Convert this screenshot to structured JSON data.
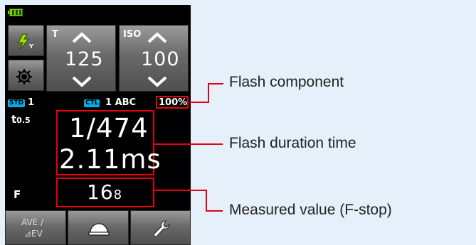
{
  "status_bar": {
    "battery_icon": "battery-full-icon"
  },
  "left_buttons": {
    "flash_mode_icon": "flash-mode-icon",
    "settings_icon": "gear-icon"
  },
  "shutter": {
    "label": "T",
    "value": "125"
  },
  "iso": {
    "label": "ISO",
    "value": "100"
  },
  "info_row": {
    "std_badge": "STD",
    "std_value": "1",
    "ctl_badge": "CTL",
    "channel": "1 ABC",
    "flash_percent": "100%"
  },
  "duration": {
    "label_t": "t",
    "label_sub": "0.5",
    "fraction": "1/474",
    "ms": "2.11ms"
  },
  "fstop": {
    "label": "F",
    "value_main": "16",
    "value_sub": "8"
  },
  "bottom_bar": {
    "ave_label": "AVE /",
    "ev_label": "⊿EV",
    "dome_icon": "dome-icon",
    "wrench_icon": "wrench-icon"
  },
  "callouts": {
    "flash_component": "Flash component",
    "flash_duration_time": "Flash duration time",
    "measured_value": "Measured value (F-stop)"
  },
  "colors": {
    "highlight": "#e60012",
    "battery": "#7cd400",
    "ctl_badge": "#00aee8"
  }
}
